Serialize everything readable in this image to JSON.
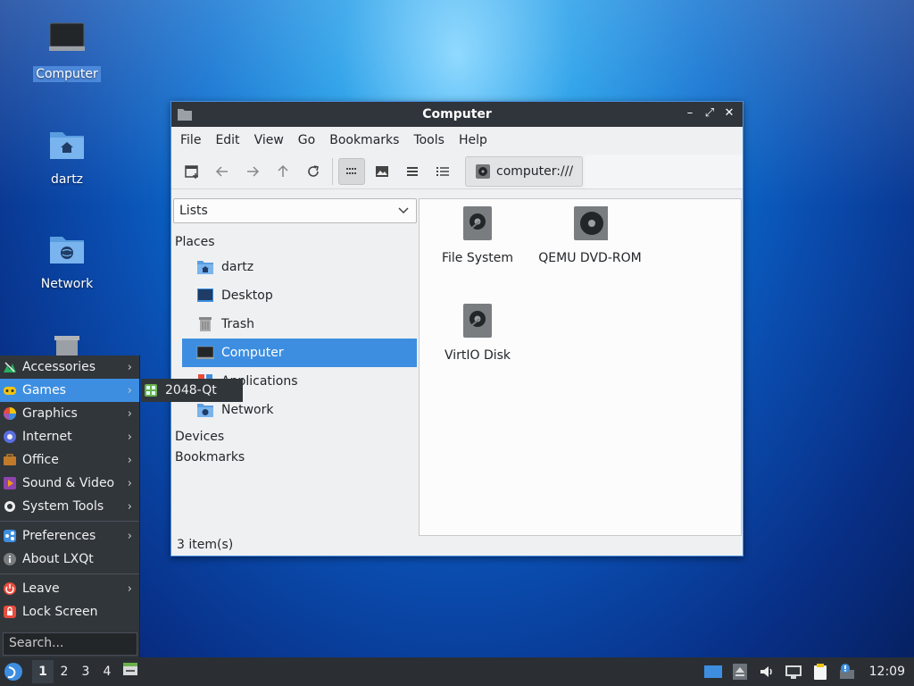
{
  "desktop": {
    "icons": [
      {
        "label": "Computer"
      },
      {
        "label": "dartz"
      },
      {
        "label": "Network"
      }
    ]
  },
  "window": {
    "title": "Computer",
    "controls": {
      "minimize": "–",
      "maximize": "⤢",
      "close": "✕"
    },
    "menu": [
      "File",
      "Edit",
      "View",
      "Go",
      "Bookmarks",
      "Tools",
      "Help"
    ],
    "path": "computer:///",
    "sidepane_mode": "Lists",
    "sections": {
      "places": "Places",
      "devices": "Devices",
      "bookmarks": "Bookmarks"
    },
    "places": [
      {
        "label": "dartz",
        "icon": "home-folder-icon"
      },
      {
        "label": "Desktop",
        "icon": "desktop-icon"
      },
      {
        "label": "Trash",
        "icon": "trash-icon"
      },
      {
        "label": "Computer",
        "icon": "computer-icon",
        "selected": true
      },
      {
        "label": "Applications",
        "icon": "applications-icon"
      },
      {
        "label": "Network",
        "icon": "network-folder-icon"
      }
    ],
    "items": [
      {
        "label": "File System"
      },
      {
        "label": "QEMU DVD-ROM"
      },
      {
        "label": "VirtIO Disk"
      }
    ],
    "status": "3 item(s)"
  },
  "startmenu": {
    "items": [
      {
        "label": "Accessories"
      },
      {
        "label": "Games"
      },
      {
        "label": "Graphics"
      },
      {
        "label": "Internet"
      },
      {
        "label": "Office"
      },
      {
        "label": "Sound & Video"
      },
      {
        "label": "System Tools"
      },
      {
        "label": "Preferences"
      },
      {
        "label": "About LXQt"
      },
      {
        "label": "Leave"
      },
      {
        "label": "Lock Screen"
      }
    ],
    "search_placeholder": "Search...",
    "submenu_item": "2048-Qt"
  },
  "taskbar": {
    "desktops": [
      "1",
      "2",
      "3",
      "4"
    ],
    "clock": "12:09"
  },
  "colors": {
    "accent": "#3d8ee0",
    "panel": "#31363b",
    "titlebar": "#30343b"
  }
}
